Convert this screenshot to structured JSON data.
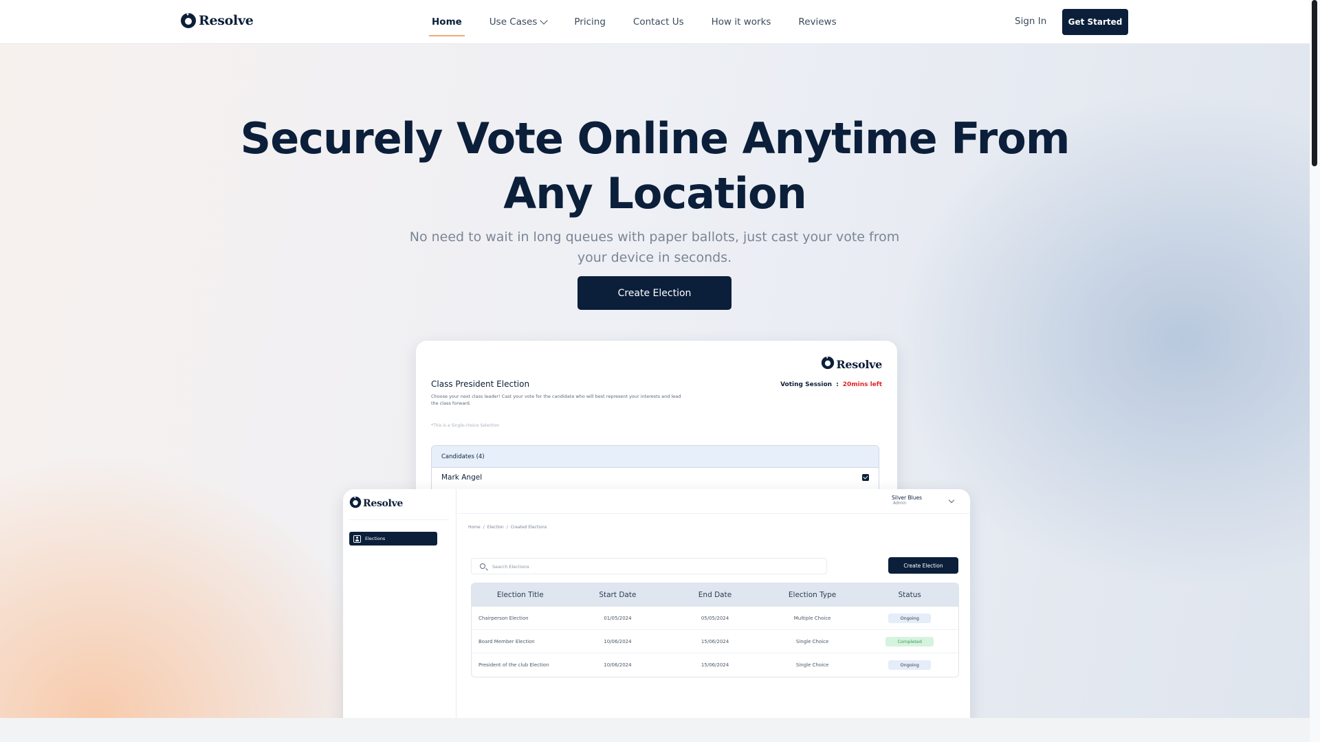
{
  "brand": {
    "name": "Resolve"
  },
  "nav": {
    "links": [
      "Home",
      "Use Cases",
      "Pricing",
      "Contact Us",
      "How it works",
      "Reviews"
    ],
    "sign_in": "Sign In",
    "get_started": "Get Started"
  },
  "hero": {
    "title_line1": "Securely Vote Online Anytime From",
    "title_line2": "Any Location",
    "subtitle": "No need to wait in long queues with paper ballots, just cast your vote from your device in seconds.",
    "cta": "Create Election"
  },
  "vote_preview": {
    "title": "Class President Election",
    "description": "Choose your next class leader! Cast your vote for the candidate who will best represent your interests and lead the class forward.",
    "note": "*This is a Single-choice Selection",
    "session_label": "Voting Session",
    "session_sep": ":",
    "time_left": "20mins left",
    "candidates_header": "Candidates (4)",
    "candidate": "Mark Angel"
  },
  "admin_preview": {
    "sidebar_item": "Elections",
    "user_name": "Silver Blues",
    "user_role": "Admin",
    "breadcrumb": [
      "Home",
      "/",
      "Election",
      "/",
      "Created Elections"
    ],
    "search_placeholder": "Search Elections",
    "create_button": "Create Election",
    "columns": [
      "Election Title",
      "Start Date",
      "End Date",
      "Election Type",
      "Status"
    ],
    "rows": [
      {
        "title": "Chairperson Election",
        "start": "01/05/2024",
        "end": "05/05/2024",
        "type": "Multiple Choice",
        "status": "Ongoing"
      },
      {
        "title": "Board Member Election",
        "start": "10/06/2024",
        "end": "15/06/2024",
        "type": "Single Choice",
        "status": "Completed"
      },
      {
        "title": "President of the club Election",
        "start": "10/06/2024",
        "end": "15/06/2024",
        "type": "Single Choice",
        "status": "Ongoing"
      }
    ]
  },
  "colors": {
    "navy": "#0b1f3a",
    "accent_underline": "#f0a77a",
    "time_left": "#e02424",
    "completed_badge": "#d6f3dd",
    "ongoing_badge": "#e4edf8"
  }
}
